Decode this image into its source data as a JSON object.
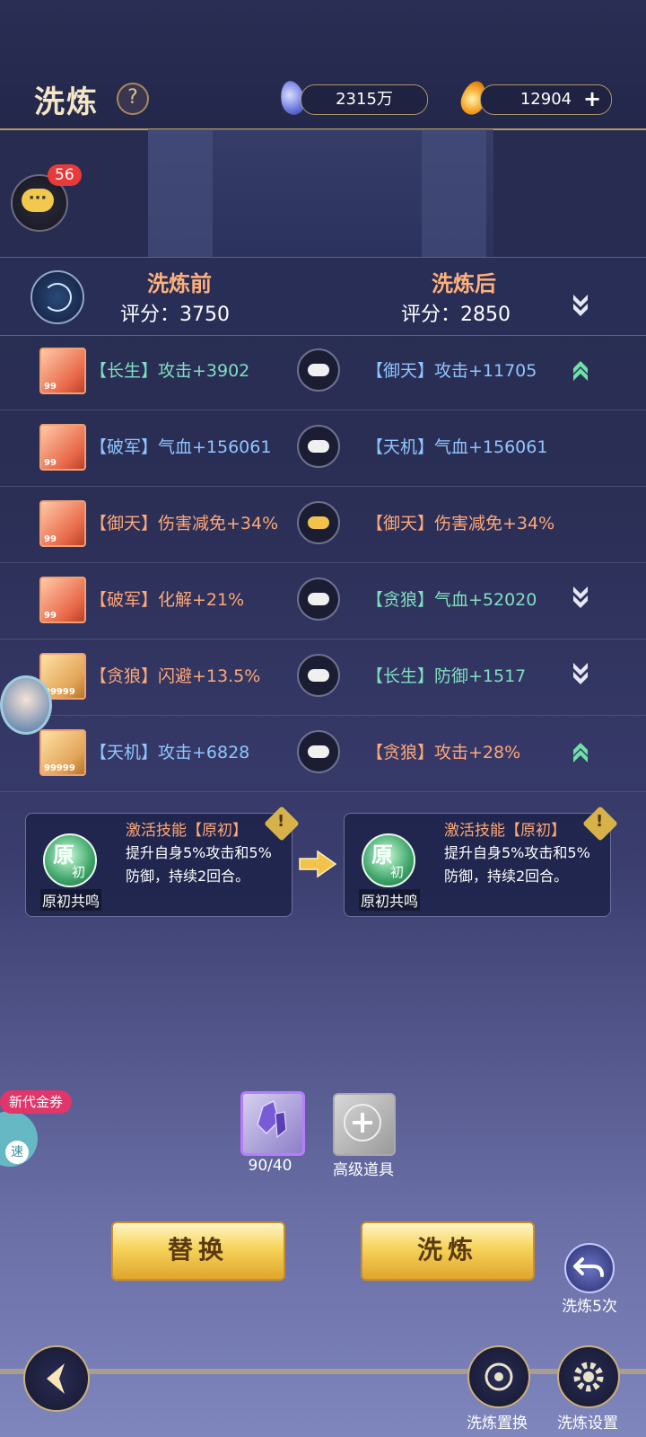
{
  "header": {
    "title": "洗炼",
    "help_icon": "question-icon",
    "silver_amount": "2315万",
    "gold_amount": "12904",
    "add_label": "+"
  },
  "chat": {
    "badge": "56",
    "icon": "chat-bubble-icon"
  },
  "compare": {
    "before_title": "洗炼前",
    "after_title": "洗炼后",
    "before_score": "评分：3750",
    "after_score": "评分：2850",
    "score_trend": "down"
  },
  "rows": [
    {
      "level": "99",
      "before": "【长生】攻击+3902",
      "before_color": "green",
      "after": "【御天】攻击+11705",
      "after_color": "blue",
      "trend": "up",
      "lock": "white"
    },
    {
      "level": "99",
      "before": "【破军】气血+156061",
      "before_color": "blue",
      "after": "【天机】气血+156061",
      "after_color": "blue",
      "trend": "",
      "lock": "white"
    },
    {
      "level": "99",
      "before": "【御天】伤害减免+34%",
      "before_color": "orange",
      "after": "【御天】伤害减免+34%",
      "after_color": "orange",
      "trend": "",
      "lock": "gold"
    },
    {
      "level": "99",
      "before": "【破军】化解+21%",
      "before_color": "orange",
      "after": "【贪狼】气血+52020",
      "after_color": "green",
      "trend": "down",
      "lock": "white"
    },
    {
      "level": "99999",
      "before": "【贪狼】闪避+13.5%",
      "before_color": "orange",
      "after": "【长生】防御+1517",
      "after_color": "green",
      "trend": "down",
      "lock": "white"
    },
    {
      "level": "99999",
      "before": "【天机】攻击+6828",
      "before_color": "blue",
      "after": "【贪狼】攻击+28%",
      "after_color": "orange",
      "trend": "up",
      "lock": "white"
    }
  ],
  "skills": {
    "before": {
      "orb_main": "原",
      "orb_sub": "初",
      "name": "原初共鸣",
      "title": "激活技能【原初】",
      "desc": "提升自身5%攻击和5%防御，持续2回合。"
    },
    "after": {
      "orb_main": "原",
      "orb_sub": "初",
      "name": "原初共鸣",
      "title": "激活技能【原初】",
      "desc": "提升自身5%攻击和5%防御，持续2回合。"
    },
    "warn": "!"
  },
  "items": {
    "crystal_count": "90/40",
    "advanced_label": "高级道具"
  },
  "side": {
    "coupon": "新代金券",
    "speed": "速"
  },
  "actions": {
    "replace": "替换",
    "refine": "洗炼",
    "refine5": "洗炼5次",
    "swap": "洗炼置换",
    "settings": "洗炼设置"
  },
  "colors": {
    "green": "#7fe0c0",
    "blue": "#8fc6ff",
    "orange": "#ffa878",
    "accent_gold": "#f6d35a"
  }
}
